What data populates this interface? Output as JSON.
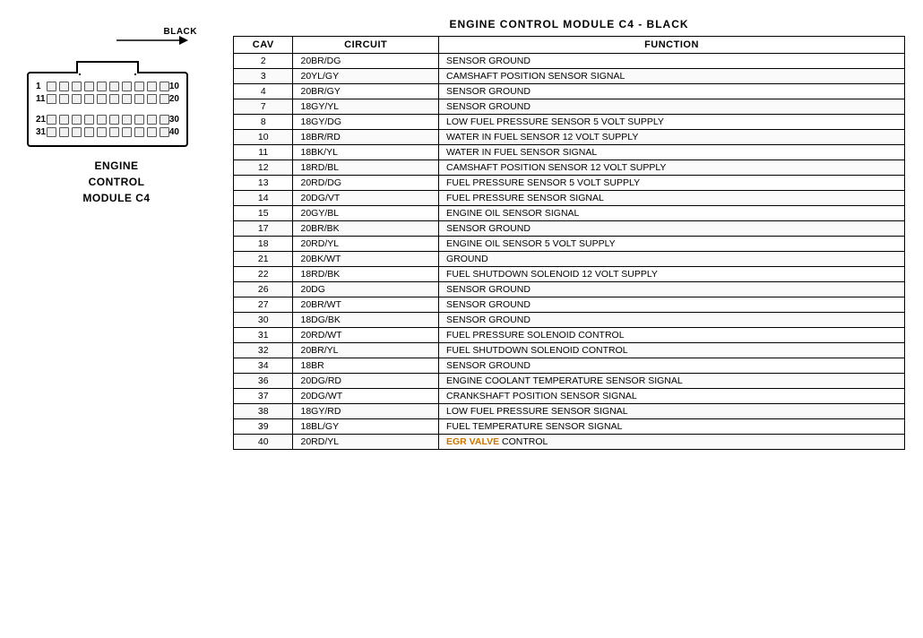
{
  "title": "ENGINE CONTROL MODULE C4 - BLACK",
  "module_label": [
    "ENGINE",
    "CONTROL",
    "MODULE C4"
  ],
  "connector_label": "BLACK",
  "columns": [
    "CAV",
    "CIRCUIT",
    "FUNCTION"
  ],
  "rows": [
    {
      "cav": "2",
      "circuit": "20BR/DG",
      "function": "SENSOR GROUND",
      "highlight": false
    },
    {
      "cav": "3",
      "circuit": "20YL/GY",
      "function": "CAMSHAFT POSITION SENSOR SIGNAL",
      "highlight": false
    },
    {
      "cav": "4",
      "circuit": "20BR/GY",
      "function": "SENSOR GROUND",
      "highlight": false
    },
    {
      "cav": "7",
      "circuit": "18GY/YL",
      "function": "SENSOR GROUND",
      "highlight": false
    },
    {
      "cav": "8",
      "circuit": "18GY/DG",
      "function": "LOW FUEL PRESSURE SENSOR 5 VOLT SUPPLY",
      "highlight": false
    },
    {
      "cav": "10",
      "circuit": "18BR/RD",
      "function": "WATER IN FUEL SENSOR 12 VOLT SUPPLY",
      "highlight": false
    },
    {
      "cav": "11",
      "circuit": "18BK/YL",
      "function": "WATER IN FUEL SENSOR SIGNAL",
      "highlight": false
    },
    {
      "cav": "12",
      "circuit": "18RD/BL",
      "function": "CAMSHAFT POSITION SENSOR 12 VOLT SUPPLY",
      "highlight": false
    },
    {
      "cav": "13",
      "circuit": "20RD/DG",
      "function": "FUEL PRESSURE SENSOR 5 VOLT SUPPLY",
      "highlight": false
    },
    {
      "cav": "14",
      "circuit": "20DG/VT",
      "function": "FUEL PRESSURE SENSOR SIGNAL",
      "highlight": false
    },
    {
      "cav": "15",
      "circuit": "20GY/BL",
      "function": "ENGINE OIL SENSOR SIGNAL",
      "highlight": false
    },
    {
      "cav": "17",
      "circuit": "20BR/BK",
      "function": "SENSOR GROUND",
      "highlight": false
    },
    {
      "cav": "18",
      "circuit": "20RD/YL",
      "function": "ENGINE OIL SENSOR 5 VOLT SUPPLY",
      "highlight": false
    },
    {
      "cav": "21",
      "circuit": "20BK/WT",
      "function": "GROUND",
      "highlight": false
    },
    {
      "cav": "22",
      "circuit": "18RD/BK",
      "function": "FUEL SHUTDOWN SOLENOID 12 VOLT SUPPLY",
      "highlight": false
    },
    {
      "cav": "26",
      "circuit": "20DG",
      "function": "SENSOR GROUND",
      "highlight": false
    },
    {
      "cav": "27",
      "circuit": "20BR/WT",
      "function": "SENSOR GROUND",
      "highlight": false
    },
    {
      "cav": "30",
      "circuit": "18DG/BK",
      "function": "SENSOR GROUND",
      "highlight": false
    },
    {
      "cav": "31",
      "circuit": "20RD/WT",
      "function": "FUEL PRESSURE SOLENOID CONTROL",
      "highlight": false
    },
    {
      "cav": "32",
      "circuit": "20BR/YL",
      "function": "FUEL SHUTDOWN SOLENOID CONTROL",
      "highlight": false
    },
    {
      "cav": "34",
      "circuit": "18BR",
      "function": "SENSOR GROUND",
      "highlight": false
    },
    {
      "cav": "36",
      "circuit": "20DG/RD",
      "function": "ENGINE COOLANT TEMPERATURE SENSOR SIGNAL",
      "highlight": false
    },
    {
      "cav": "37",
      "circuit": "20DG/WT",
      "function": "CRANKSHAFT POSITION SENSOR SIGNAL",
      "highlight": false
    },
    {
      "cav": "38",
      "circuit": "18GY/RD",
      "function": "LOW FUEL PRESSURE SENSOR SIGNAL",
      "highlight": false
    },
    {
      "cav": "39",
      "circuit": "18BL/GY",
      "function": "FUEL TEMPERATURE SENSOR SIGNAL",
      "highlight": false
    },
    {
      "cav": "40",
      "circuit": "20RD/YL",
      "function_prefix": "",
      "function_highlight": "EGR VALVE",
      "function_suffix": " CONTROL",
      "highlight": true
    }
  ],
  "pin_rows": [
    {
      "left": "1",
      "pins": 9,
      "right": "10"
    },
    {
      "left": "11",
      "pins": 9,
      "right": "20"
    },
    {
      "left": "21",
      "pins": 9,
      "right": "30"
    },
    {
      "left": "31",
      "pins": 9,
      "right": "40"
    }
  ]
}
